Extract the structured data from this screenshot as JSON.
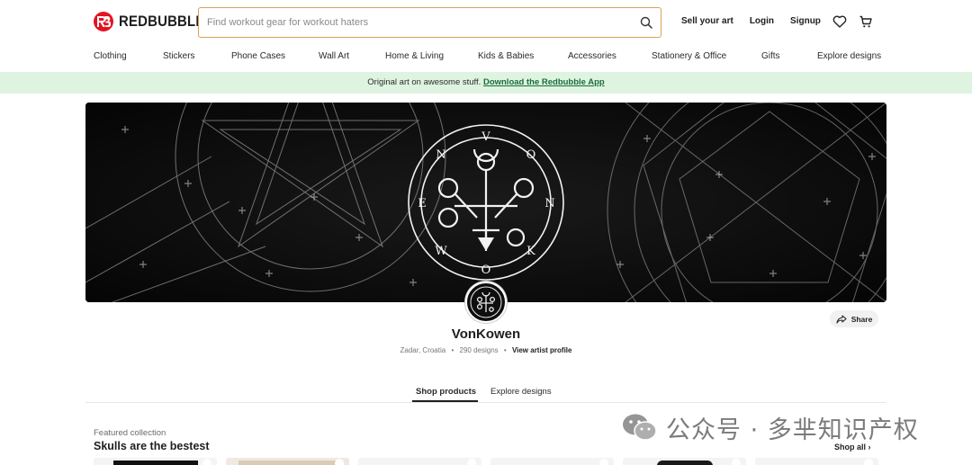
{
  "brand": {
    "name": "REDBUBBLE",
    "accent": "#e41321"
  },
  "search": {
    "placeholder": "Find workout gear for workout haters",
    "value": ""
  },
  "header_links": {
    "sell": "Sell your art",
    "login": "Login",
    "signup": "Signup"
  },
  "nav": [
    "Clothing",
    "Stickers",
    "Phone Cases",
    "Wall Art",
    "Home & Living",
    "Kids & Babies",
    "Accessories",
    "Stationery & Office",
    "Gifts",
    "Explore designs"
  ],
  "promo": {
    "text": "Original art on awesome stuff.",
    "link": "Download the Redbubble App",
    "bg": "#def4e1"
  },
  "cover": {
    "sigil_letters": [
      "V",
      "O",
      "N",
      "K",
      "O",
      "W",
      "E",
      "N"
    ],
    "background": "#0b0b0b"
  },
  "share": {
    "label": "Share"
  },
  "artist": {
    "name": "VonKowen",
    "location": "Zadar, Croatia",
    "designs": "290 designs",
    "profile_link": "View artist profile"
  },
  "tabs": {
    "shop": "Shop products",
    "explore": "Explore designs"
  },
  "featured": {
    "label": "Featured collection",
    "title": "Skulls are the bestest",
    "shop_all": "Shop all"
  },
  "watermark": {
    "text": "公众号 · 多芈知识产权"
  },
  "icons": {
    "search": "search-icon",
    "heart": "heart-icon",
    "cart": "cart-icon",
    "share": "share-arrow-icon"
  }
}
